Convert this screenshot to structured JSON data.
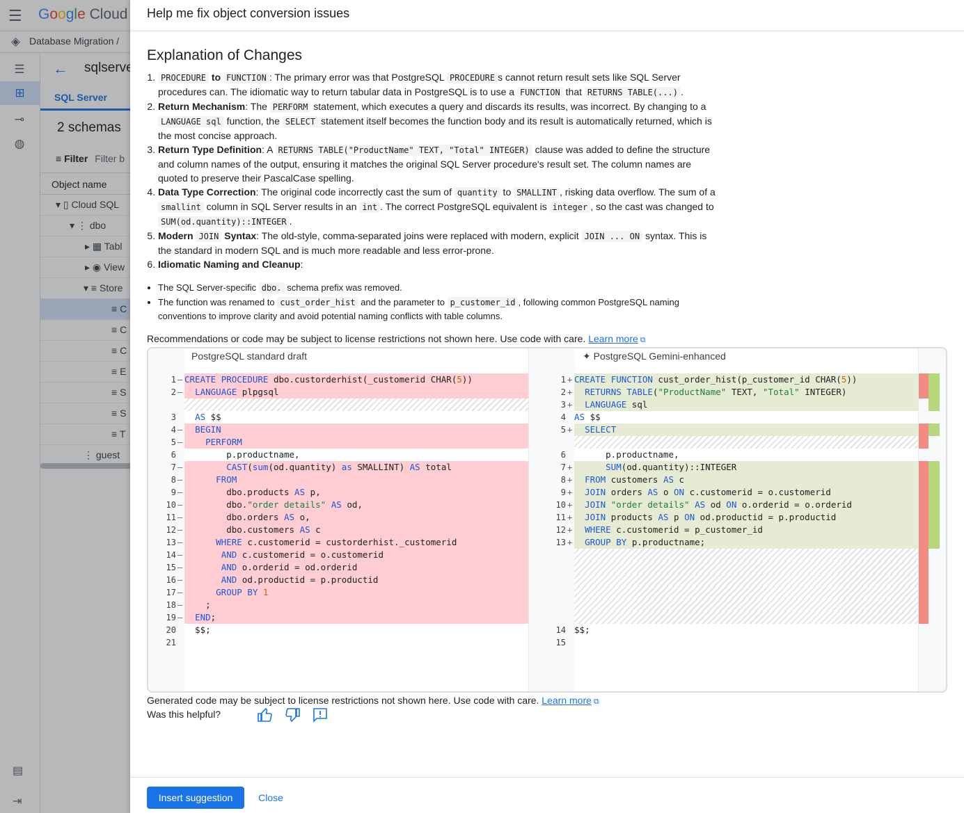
{
  "console": {
    "brand": {
      "g": "G",
      "o1": "o",
      "o2": "o",
      "g2": "g",
      "l": "l",
      "e": "e",
      "cloud": "Cloud"
    },
    "breadcrumb": "Database Migration  /",
    "panel_title": "sqlserve",
    "tab": "SQL Server",
    "schemas": "2 schemas",
    "filter_label": "Filter",
    "filter_placeholder": "Filter b",
    "column_header": "Object name",
    "tree": [
      "Cloud SQL",
      "dbo",
      "Tabl",
      "View",
      "Store",
      "C",
      "C",
      "C",
      "E",
      "S",
      "S",
      "T",
      "guest"
    ]
  },
  "dialog": {
    "title": "Help me fix object conversion issues",
    "explanation_title": "Explanation of Changes",
    "items": {
      "i1": {
        "c1": "PROCEDURE",
        "to": "to",
        "c2": "FUNCTION",
        "t1": ": The primary error was that PostgreSQL ",
        "c3": "PROCEDURE",
        "t2": "s cannot return result sets like SQL Server procedures can. The idiomatic way to return tabular data in PostgreSQL is to use a ",
        "c4": "FUNCTION",
        "t3": " that ",
        "c5": "RETURNS TABLE(...)",
        "t4": "."
      },
      "i2": {
        "b": "Return Mechanism",
        "t1": ": The ",
        "c1": "PERFORM",
        "t2": " statement, which executes a query and discards its results, was incorrect. By changing to a ",
        "c2": "LANGUAGE sql",
        "t3": " function, the ",
        "c3": "SELECT",
        "t4": " statement itself becomes the function body and its result is automatically returned, which is the most concise approach."
      },
      "i3": {
        "b": "Return Type Definition",
        "t1": ": A ",
        "c1": "RETURNS TABLE(\"ProductName\" TEXT, \"Total\" INTEGER)",
        "t2": " clause was added to define the structure and column names of the output, ensuring it matches the original SQL Server procedure's result set. The column names are quoted to preserve their PascalCase spelling."
      },
      "i4": {
        "b": "Data Type Correction",
        "t1": ": The original code incorrectly cast the sum of ",
        "c1": "quantity",
        "t2": " to ",
        "c2": "SMALLINT",
        "t3": ", risking data overflow. The sum of a ",
        "c3": "smallint",
        "t4": " column in SQL Server results in an ",
        "c4": "int",
        "t5": ". The correct PostgreSQL equivalent is ",
        "c5": "integer",
        "t6": ", so the cast was changed to ",
        "c6": "SUM(od.quantity)::INTEGER",
        "t7": "."
      },
      "i5": {
        "b1": "Modern ",
        "c1": "JOIN",
        "b2": " Syntax",
        "t1": ": The old-style, comma-separated joins were replaced with modern, explicit ",
        "c2": "JOIN ... ON",
        "t2": " syntax. This is the standard in modern SQL and is much more readable and less error-prone."
      },
      "i6": {
        "b": "Idiomatic Naming and Cleanup",
        "t1": ":"
      },
      "s1": {
        "t1": "The SQL Server-specific ",
        "c1": "dbo.",
        "t2": " schema prefix was removed."
      },
      "s2": {
        "t1": "The function was renamed to ",
        "c1": "cust_order_hist",
        "t2": " and the parameter to ",
        "c2": "p_customer_id",
        "t3": ", following common PostgreSQL naming conventions to improve clarity and avoid potential naming conflicts with table columns."
      }
    },
    "recommendation": "Recommendations or code may be subject to license restrictions not shown here. Use code with care.",
    "learn_more": "Learn more",
    "left_header": "PostgreSQL standard draft",
    "right_header": "PostgreSQL Gemini-enhanced",
    "sparkle": "✦",
    "generated_notice": "Generated code may be subject to license restrictions not shown here. Use code with care.",
    "helpful": "Was this helpful?",
    "insert_button": "Insert suggestion",
    "close_button": "Close"
  },
  "left_code": [
    {
      "n": "1",
      "m": "—",
      "text": "CREATE PROCEDURE dbo.custorderhist(_customerid CHAR(5))",
      "cls": "del"
    },
    {
      "n": "2",
      "m": "—",
      "text": "  LANGUAGE plpgsql",
      "cls": "del"
    },
    {
      "n": "",
      "m": "",
      "text": "",
      "cls": "hatch"
    },
    {
      "n": "3",
      "m": "",
      "text": "  AS $$",
      "cls": ""
    },
    {
      "n": "4",
      "m": "—",
      "text": "  BEGIN",
      "cls": "del"
    },
    {
      "n": "5",
      "m": "—",
      "text": "    PERFORM",
      "cls": "del"
    },
    {
      "n": "6",
      "m": "",
      "text": "        p.productname,",
      "cls": ""
    },
    {
      "n": "7",
      "m": "—",
      "text": "        CAST(sum(od.quantity) as SMALLINT) AS total",
      "cls": "del"
    },
    {
      "n": "8",
      "m": "—",
      "text": "      FROM",
      "cls": "del"
    },
    {
      "n": "9",
      "m": "—",
      "text": "        dbo.products AS p,",
      "cls": "del"
    },
    {
      "n": "10",
      "m": "—",
      "text": "        dbo.\"order details\" AS od,",
      "cls": "del"
    },
    {
      "n": "11",
      "m": "—",
      "text": "        dbo.orders AS o,",
      "cls": "del"
    },
    {
      "n": "12",
      "m": "—",
      "text": "        dbo.customers AS c",
      "cls": "del"
    },
    {
      "n": "13",
      "m": "—",
      "text": "      WHERE c.customerid = custorderhist._customerid",
      "cls": "del"
    },
    {
      "n": "14",
      "m": "—",
      "text": "       AND c.customerid = o.customerid",
      "cls": "del"
    },
    {
      "n": "15",
      "m": "—",
      "text": "       AND o.orderid = od.orderid",
      "cls": "del"
    },
    {
      "n": "16",
      "m": "—",
      "text": "       AND od.productid = p.productid",
      "cls": "del"
    },
    {
      "n": "17",
      "m": "—",
      "text": "      GROUP BY 1",
      "cls": "del"
    },
    {
      "n": "18",
      "m": "—",
      "text": "    ;",
      "cls": "del"
    },
    {
      "n": "19",
      "m": "—",
      "text": "  END;",
      "cls": "del"
    },
    {
      "n": "20",
      "m": "",
      "text": "  $$;",
      "cls": ""
    },
    {
      "n": "21",
      "m": "",
      "text": "",
      "cls": ""
    }
  ],
  "right_code": [
    {
      "n": "1",
      "m": "+",
      "text": "CREATE FUNCTION cust_order_hist(p_customer_id CHAR(5))",
      "cls": "ins"
    },
    {
      "n": "2",
      "m": "+",
      "text": "  RETURNS TABLE(\"ProductName\" TEXT, \"Total\" INTEGER)",
      "cls": "ins"
    },
    {
      "n": "3",
      "m": "+",
      "text": "  LANGUAGE sql",
      "cls": "ins"
    },
    {
      "n": "4",
      "m": "",
      "text": "AS $$",
      "cls": ""
    },
    {
      "n": "5",
      "m": "+",
      "text": "  SELECT",
      "cls": "ins"
    },
    {
      "n": "",
      "m": "",
      "text": "",
      "cls": "hatch"
    },
    {
      "n": "6",
      "m": "",
      "text": "      p.productname,",
      "cls": ""
    },
    {
      "n": "7",
      "m": "+",
      "text": "      SUM(od.quantity)::INTEGER",
      "cls": "ins"
    },
    {
      "n": "8",
      "m": "+",
      "text": "  FROM customers AS c",
      "cls": "ins"
    },
    {
      "n": "9",
      "m": "+",
      "text": "  JOIN orders AS o ON c.customerid = o.customerid",
      "cls": "ins"
    },
    {
      "n": "10",
      "m": "+",
      "text": "  JOIN \"order details\" AS od ON o.orderid = o.orderid",
      "cls": "ins"
    },
    {
      "n": "11",
      "m": "+",
      "text": "  JOIN products AS p ON od.productid = p.productid",
      "cls": "ins"
    },
    {
      "n": "12",
      "m": "+",
      "text": "  WHERE c.customerid = p_customer_id",
      "cls": "ins"
    },
    {
      "n": "13",
      "m": "+",
      "text": "  GROUP BY p.productname;",
      "cls": "ins"
    },
    {
      "n": "",
      "m": "",
      "text": "",
      "cls": "hatch"
    },
    {
      "n": "",
      "m": "",
      "text": "",
      "cls": "hatch"
    },
    {
      "n": "",
      "m": "",
      "text": "",
      "cls": "hatch"
    },
    {
      "n": "",
      "m": "",
      "text": "",
      "cls": "hatch"
    },
    {
      "n": "",
      "m": "",
      "text": "",
      "cls": "hatch"
    },
    {
      "n": "",
      "m": "",
      "text": "",
      "cls": "hatch"
    },
    {
      "n": "14",
      "m": "",
      "text": "$$;",
      "cls": ""
    },
    {
      "n": "15",
      "m": "",
      "text": "",
      "cls": ""
    }
  ],
  "icons": {
    "hamburger": "menu-icon",
    "back": "arrow-back-icon",
    "sparkle": "sparkle-icon",
    "thumb_up": "thumb-up-icon",
    "thumb_down": "thumb-down-icon",
    "feedback": "feedback-icon",
    "external": "open-in-new-icon",
    "revert_arrow": "arrow-right-icon"
  },
  "colors": {
    "accent": "#1a73e8",
    "deleted_line": "#ffcdd2",
    "inserted_line": "#e6ecd3",
    "overview_removed": "#f28b82",
    "overview_added": "#b5d67a"
  }
}
